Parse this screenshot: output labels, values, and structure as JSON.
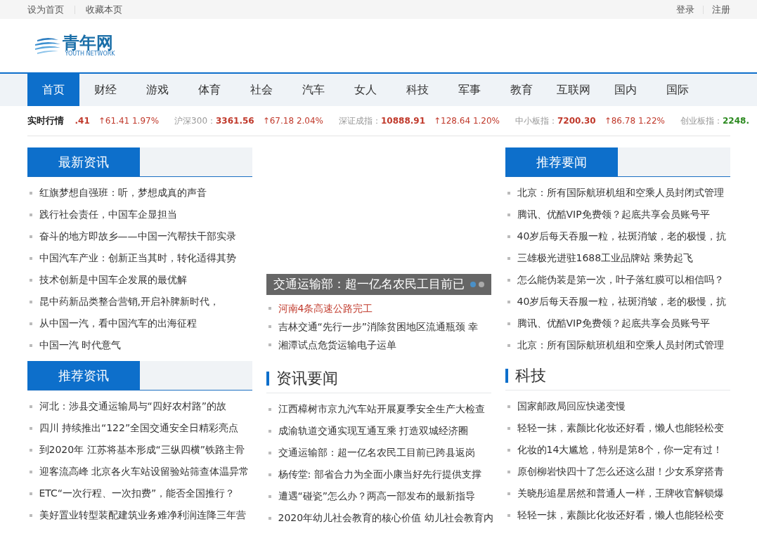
{
  "top_bar": {
    "left_links": [
      "设为首页",
      "收藏本页"
    ],
    "right_links": [
      "登录",
      "注册"
    ]
  },
  "logo": {
    "name": "青年网",
    "tagline": "YOUTH NETWORK"
  },
  "nav": [
    {
      "label": "首页",
      "selected": true
    },
    {
      "label": "财经",
      "selected": false
    },
    {
      "label": "游戏",
      "selected": false
    },
    {
      "label": "体育",
      "selected": false
    },
    {
      "label": "社会",
      "selected": false
    },
    {
      "label": "汽车",
      "selected": false
    },
    {
      "label": "女人",
      "selected": false
    },
    {
      "label": "科技",
      "selected": false
    },
    {
      "label": "军事",
      "selected": false
    },
    {
      "label": "教育",
      "selected": false
    },
    {
      "label": "互联网",
      "selected": false
    },
    {
      "label": "国内",
      "selected": false
    },
    {
      "label": "国际",
      "selected": false
    }
  ],
  "ticker": {
    "label": "实时行情",
    "items": [
      {
        "value": ".41",
        "change": "↑61.41 1.97%",
        "color": "#c0392b"
      },
      {
        "name": "沪深300：",
        "value": "3361.56",
        "change": "↑67.18 2.04%",
        "color": "#c0392b"
      },
      {
        "name": "深证成指：",
        "value": "10888.91",
        "change": "↑128.64 1.20%",
        "color": "#c0392b"
      },
      {
        "name": "中小板指：",
        "value": "7200.30",
        "change": "↑86.78 1.22%",
        "color": "#c0392b"
      },
      {
        "name": "创业板指：",
        "value": "2248.",
        "color": "#2e8b22"
      }
    ]
  },
  "columns": [
    [
      {
        "kind": "tab",
        "title": "最新资讯",
        "items": [
          {
            "text": "红旗梦想自强班：听，梦想成真的声音"
          },
          {
            "text": "践行社会责任，中国车企显担当"
          },
          {
            "text": "奋斗的地方即故乡——中国一汽帮扶干部实录"
          },
          {
            "text": "中国汽车产业：创新正当其时，转化适得其势"
          },
          {
            "text": "技术创新是中国车企发展的最优解"
          },
          {
            "text": "昆中药新品类整合营销,开启补脾新时代，"
          },
          {
            "text": "从中国一汽，看中国汽车的出海征程"
          },
          {
            "text": "中国一汽 时代意气"
          }
        ]
      },
      {
        "kind": "tab",
        "title": "推荐资讯",
        "items": [
          {
            "text": "河北：涉县交通运输局与“四好农村路”的故"
          },
          {
            "text": "四川 持续推出“122”全国交通安全日精彩亮点"
          },
          {
            "text": "到2020年 江苏将基本形成“三纵四横”铁路主骨"
          },
          {
            "text": "迎客流高峰 北京各火车站设留验站筛查体温异常"
          },
          {
            "text": "ETC“一次行程、一次扣费”，能否全国推行？"
          },
          {
            "text": "美好置业转型装配建筑业务难净利润连降三年营"
          }
        ]
      }
    ],
    [
      {
        "kind": "slideshow",
        "caption": "交通运输部：超一亿名农民工目前已",
        "dots": [
          {
            "selected": true
          },
          {
            "selected": false
          }
        ],
        "items": [
          {
            "text": "河南4条高速公路完工",
            "highlighted": true
          },
          {
            "text": "吉林交通“先行一步”消除贫困地区流通瓶颈 幸",
            "highlighted": false
          },
          {
            "text": "湘潭试点危货运输电子运单",
            "highlighted": false
          }
        ]
      },
      {
        "kind": "bar",
        "title": "资讯要闻",
        "items": [
          {
            "text": "江西樟树市京九汽车站开展夏季安全生产大检查"
          },
          {
            "text": "成渝轨道交通实现互通互乘 打造双城经济圈"
          },
          {
            "text": "交通运输部：超一亿名农民工目前已跨县返岗"
          },
          {
            "text": "杨传堂: 部省合力为全面小康当好先行提供支撑"
          },
          {
            "text": "遭遇“碰瓷”怎么办？两高一部发布的最新指导"
          },
          {
            "text": "2020年幼儿社会教育的核心价值 幼儿社会教育内"
          }
        ]
      }
    ],
    [
      {
        "kind": "tab",
        "title": "推荐要闻",
        "items": [
          {
            "text": "北京：所有国际航班机组和空乘人员封闭式管理"
          },
          {
            "text": "腾讯、优酷VIP免费领？起底共享会员账号平"
          },
          {
            "text": "40岁后每天吞服一粒，祛斑消皱，老的极慢，抗"
          },
          {
            "text": "三雄极光进驻1688工业品牌站 乘势起飞"
          },
          {
            "text": "怎么能伪装是第一次，叶子落红膜可以相信吗？"
          },
          {
            "text": "40岁后每天吞服一粒，祛斑消皱，老的极慢，抗"
          },
          {
            "text": "腾讯、优酷VIP免费领？起底共享会员账号平"
          },
          {
            "text": "北京：所有国际航班机组和空乘人员封闭式管理"
          }
        ]
      },
      {
        "kind": "bar",
        "title": "科技",
        "items": [
          {
            "text": "国家邮政局回应快递变慢"
          },
          {
            "text": "轻轻一抹，素颜比化妆还好看，懒人也能轻松变"
          },
          {
            "text": "化妆的14大尴尬，特别是第8个，你一定有过！"
          },
          {
            "text": "原创柳岩快四十了怎么还这么甜！少女系穿搭青"
          },
          {
            "text": "关晓彤追星居然和普通人一样，王牌收官解锁爆"
          },
          {
            "text": "轻轻一抹，素颜比化妆还好看，懒人也能轻松变"
          }
        ]
      }
    ]
  ]
}
